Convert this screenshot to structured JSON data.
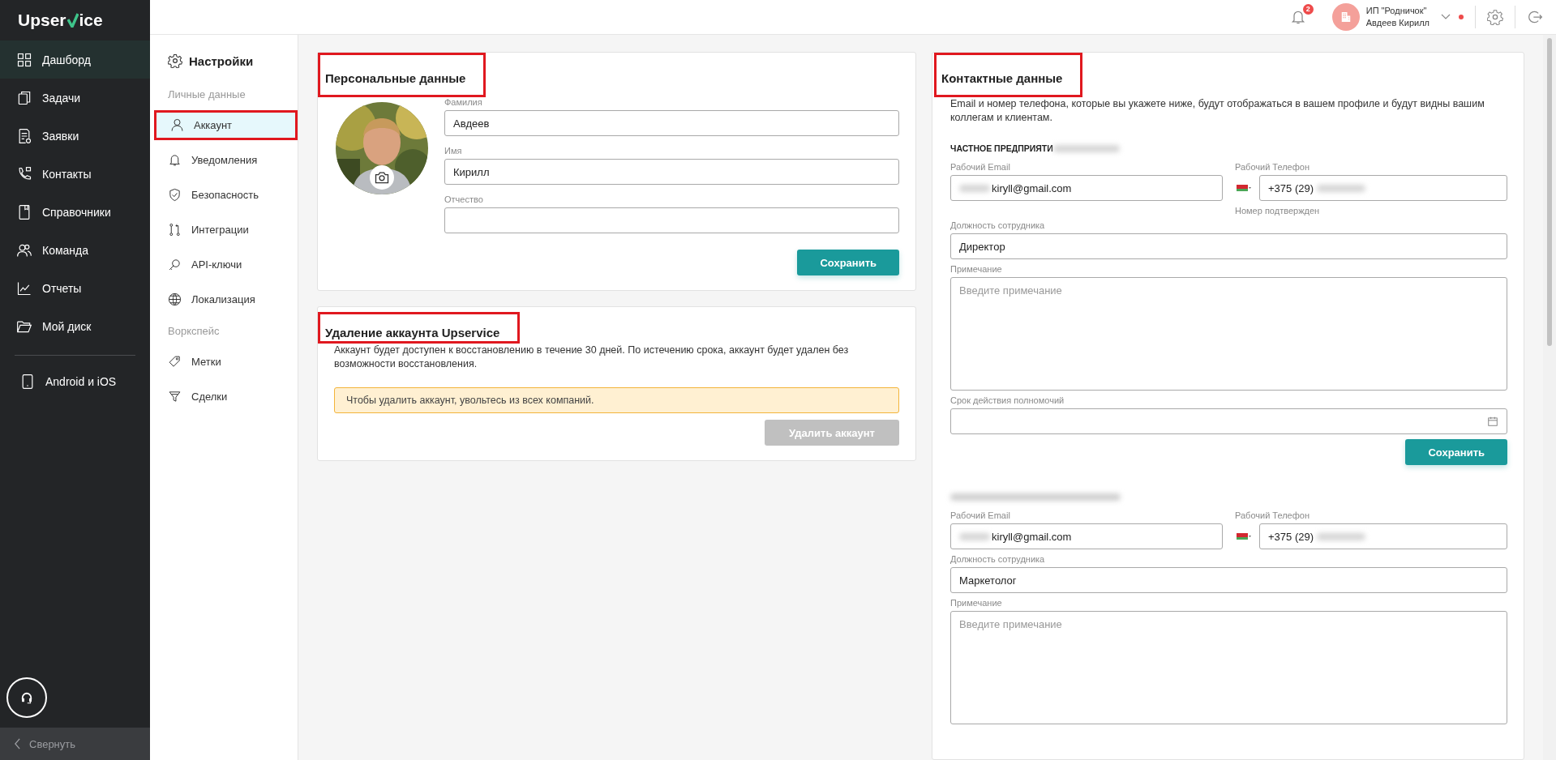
{
  "sidebar": {
    "logo_start": "Upser",
    "logo_end": "ice",
    "items": [
      {
        "label": "Дашборд",
        "selected": true
      },
      {
        "label": "Задачи",
        "selected": false
      },
      {
        "label": "Заявки",
        "selected": false
      },
      {
        "label": "Контакты",
        "selected": false
      },
      {
        "label": "Справочники",
        "selected": false
      },
      {
        "label": "Команда",
        "selected": false
      },
      {
        "label": "Отчеты",
        "selected": false
      },
      {
        "label": "Мой диск",
        "selected": false
      }
    ],
    "apps": {
      "label": "Android и iOS"
    },
    "collapse": "Свернуть"
  },
  "topbar": {
    "notifications": "2",
    "company": "ИП \"Родничок\"",
    "user": "Авдеев Кирилл"
  },
  "settings_nav": {
    "title": "Настройки",
    "groups": [
      {
        "heading": "Личные данные",
        "items": [
          {
            "label": "Аккаунт",
            "selected": true,
            "highlighted": true
          },
          {
            "label": "Уведомления",
            "selected": false,
            "highlighted": false
          },
          {
            "label": "Безопасность",
            "selected": false,
            "highlighted": false
          },
          {
            "label": "Интеграции",
            "selected": false,
            "highlighted": false
          },
          {
            "label": "API-ключи",
            "selected": false,
            "highlighted": false
          },
          {
            "label": "Локализация",
            "selected": false,
            "highlighted": false
          }
        ]
      },
      {
        "heading": "Воркспейс",
        "items": [
          {
            "label": "Метки",
            "selected": false,
            "highlighted": false
          },
          {
            "label": "Сделки",
            "selected": false,
            "highlighted": false
          }
        ]
      }
    ]
  },
  "personal": {
    "title": "Персональные данные",
    "highlighted": true,
    "fields": [
      {
        "label": "Фамилия",
        "value": "Авдеев"
      },
      {
        "label": "Имя",
        "value": "Кирилл"
      },
      {
        "label": "Отчество"
      }
    ],
    "save": "Сохранить"
  },
  "deletion": {
    "title": "Удаление аккаунта Upservice",
    "highlighted": true,
    "text": "Аккаунт будет доступен к восстановлению в течение 30 дней. По истечению срока, аккаунт будет удален без возможности восстановления.",
    "warning": "Чтобы удалить аккаунт, увольтесь из всех компаний.",
    "button": {
      "label": "Удалить аккаунт",
      "disabled": true
    }
  },
  "contacts": {
    "title": "Контактные данные",
    "highlighted": true,
    "description": "Email и номер телефона, которые вы укажете ниже, будут отображаться в вашем профиле и будут видны вашим коллегам и клиентам.",
    "companies": [
      {
        "name": "ЧАСТНОЕ ПРЕДПРИЯТИ",
        "name_redacted": true,
        "email_label": "Рабочий Email",
        "email": "kiryll@gmail.com",
        "phone_label": "Рабочий Телефон",
        "phone": "+375 (29)",
        "phone_status": "Номер подтвержден",
        "position_label": "Должность сотрудника",
        "position": "Директор",
        "note_label": "Примечание",
        "note_placeholder": "Введите примечание",
        "term_label": "Срок действия полномочий",
        "save": "Сохранить"
      },
      {
        "name_redacted": true,
        "email_label": "Рабочий Email",
        "email": "kiryll@gmail.com",
        "phone_label": "Рабочий Телефон",
        "phone": "+375 (29)",
        "position_label": "Должность сотрудника",
        "position": "Маркетолог",
        "note_label": "Примечание",
        "note_placeholder": "Введите примечание"
      }
    ]
  }
}
